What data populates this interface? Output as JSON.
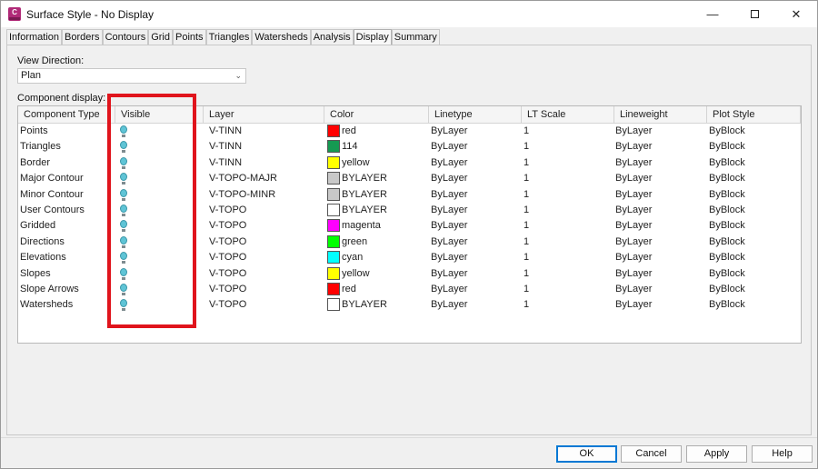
{
  "window": {
    "title": "Surface Style - No Display",
    "app_icon_letter": "C"
  },
  "tabs": [
    {
      "label": "Information"
    },
    {
      "label": "Borders"
    },
    {
      "label": "Contours"
    },
    {
      "label": "Grid"
    },
    {
      "label": "Points"
    },
    {
      "label": "Triangles"
    },
    {
      "label": "Watersheds"
    },
    {
      "label": "Analysis"
    },
    {
      "label": "Display",
      "active": true
    },
    {
      "label": "Summary"
    }
  ],
  "view_direction": {
    "label": "View Direction:",
    "value": "Plan"
  },
  "component_display": {
    "label": "Component display:",
    "columns": [
      "Component Type",
      "Visible",
      "Layer",
      "Color",
      "Linetype",
      "LT Scale",
      "Lineweight",
      "Plot Style"
    ],
    "rows": [
      {
        "type": "Points",
        "visible": true,
        "layer": "V-TINN",
        "color_name": "red",
        "color_hex": "#ff0000",
        "linetype": "ByLayer",
        "lt_scale": "1",
        "lineweight": "ByLayer",
        "plot_style": "ByBlock"
      },
      {
        "type": "Triangles",
        "visible": true,
        "layer": "V-TINN",
        "color_name": "114",
        "color_hex": "#159a52",
        "linetype": "ByLayer",
        "lt_scale": "1",
        "lineweight": "ByLayer",
        "plot_style": "ByBlock"
      },
      {
        "type": "Border",
        "visible": true,
        "layer": "V-TINN",
        "color_name": "yellow",
        "color_hex": "#ffff00",
        "linetype": "ByLayer",
        "lt_scale": "1",
        "lineweight": "ByLayer",
        "plot_style": "ByBlock"
      },
      {
        "type": "Major Contour",
        "visible": true,
        "layer": "V-TOPO-MAJR",
        "color_name": "BYLAYER",
        "color_hex": "#c8c8c8",
        "linetype": "ByLayer",
        "lt_scale": "1",
        "lineweight": "ByLayer",
        "plot_style": "ByBlock"
      },
      {
        "type": "Minor Contour",
        "visible": true,
        "layer": "V-TOPO-MINR",
        "color_name": "BYLAYER",
        "color_hex": "#c8c8c8",
        "linetype": "ByLayer",
        "lt_scale": "1",
        "lineweight": "ByLayer",
        "plot_style": "ByBlock"
      },
      {
        "type": "User Contours",
        "visible": true,
        "layer": "V-TOPO",
        "color_name": "BYLAYER",
        "color_hex": "#ffffff",
        "linetype": "ByLayer",
        "lt_scale": "1",
        "lineweight": "ByLayer",
        "plot_style": "ByBlock"
      },
      {
        "type": "Gridded",
        "visible": true,
        "layer": "V-TOPO",
        "color_name": "magenta",
        "color_hex": "#ff00ff",
        "linetype": "ByLayer",
        "lt_scale": "1",
        "lineweight": "ByLayer",
        "plot_style": "ByBlock"
      },
      {
        "type": "Directions",
        "visible": true,
        "layer": "V-TOPO",
        "color_name": "green",
        "color_hex": "#00ff00",
        "linetype": "ByLayer",
        "lt_scale": "1",
        "lineweight": "ByLayer",
        "plot_style": "ByBlock"
      },
      {
        "type": "Elevations",
        "visible": true,
        "layer": "V-TOPO",
        "color_name": "cyan",
        "color_hex": "#00ffff",
        "linetype": "ByLayer",
        "lt_scale": "1",
        "lineweight": "ByLayer",
        "plot_style": "ByBlock"
      },
      {
        "type": "Slopes",
        "visible": true,
        "layer": "V-TOPO",
        "color_name": "yellow",
        "color_hex": "#ffff00",
        "linetype": "ByLayer",
        "lt_scale": "1",
        "lineweight": "ByLayer",
        "plot_style": "ByBlock"
      },
      {
        "type": "Slope Arrows",
        "visible": true,
        "layer": "V-TOPO",
        "color_name": "red",
        "color_hex": "#ff0000",
        "linetype": "ByLayer",
        "lt_scale": "1",
        "lineweight": "ByLayer",
        "plot_style": "ByBlock"
      },
      {
        "type": "Watersheds",
        "visible": true,
        "layer": "V-TOPO",
        "color_name": "BYLAYER",
        "color_hex": "#ffffff",
        "linetype": "ByLayer",
        "lt_scale": "1",
        "lineweight": "ByLayer",
        "plot_style": "ByBlock"
      }
    ]
  },
  "buttons": {
    "ok": "OK",
    "cancel": "Cancel",
    "apply": "Apply",
    "help": "Help"
  },
  "icons": {
    "visible": "lightbulb-icon",
    "minimize": "minimize-icon",
    "maximize": "maximize-icon",
    "close": "close-icon"
  },
  "colors": {
    "highlight": "#e0141c",
    "accent": "#0078d4",
    "bulb": "#5fc4d6"
  }
}
